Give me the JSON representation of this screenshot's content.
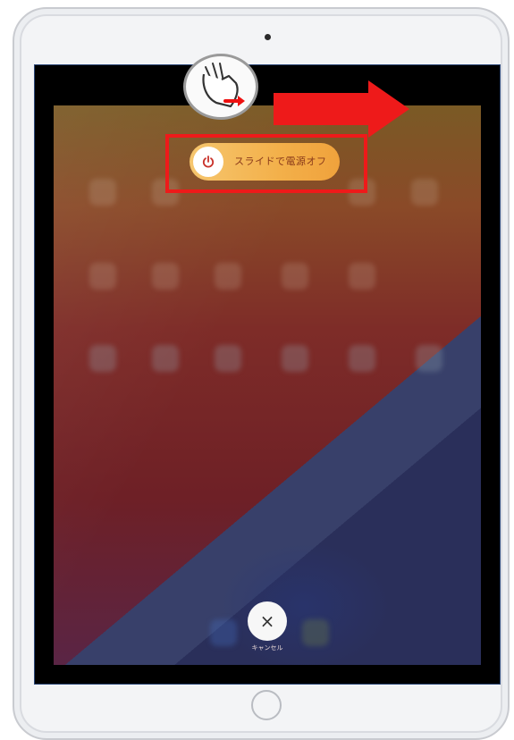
{
  "device": {
    "name": "iPad",
    "screen": {
      "power_off_slider": {
        "label": "スライドで電源オフ"
      },
      "cancel": {
        "symbol": "×",
        "label": "キャンセル"
      }
    }
  },
  "annotations": {
    "slider_highlight_color": "#ee1a1a",
    "arrow_color": "#ee1a1a",
    "hand_icon": "finger-swipe-right-icon"
  },
  "colors": {
    "slider_gradient": [
      "#f6c66e",
      "#f0a23c"
    ],
    "power_icon": "#c9322a"
  }
}
